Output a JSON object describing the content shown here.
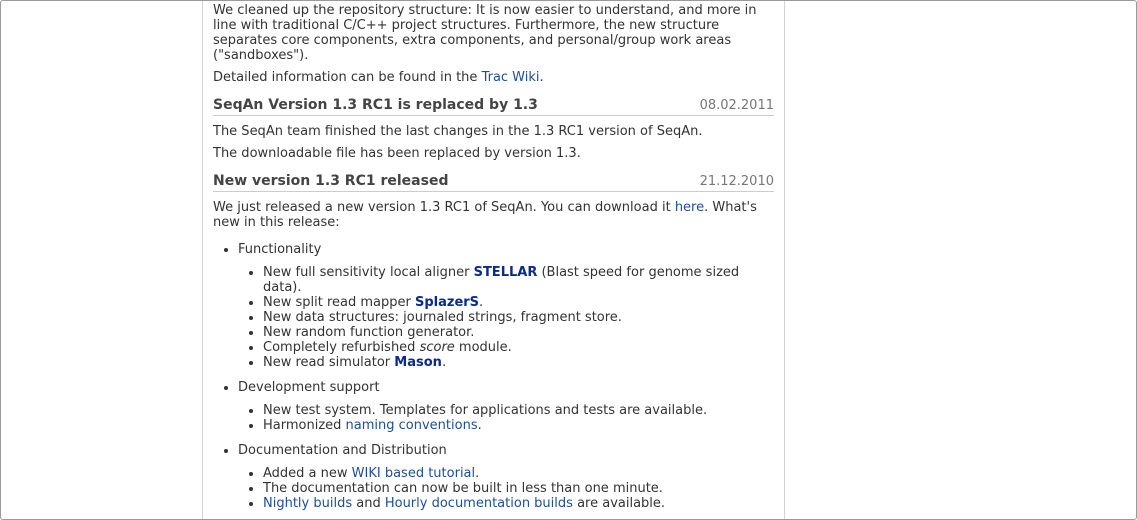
{
  "intro": {
    "p1": "We cleaned up the repository structure: It is now easier to understand, and more in line with traditional C/C++ project structures. Furthermore, the new structure separates core components, extra components, and personal/group work areas (\"sandboxes\").",
    "p2_before": "Detailed information can be found in the ",
    "p2_link": "Trac Wiki",
    "p2_after": "."
  },
  "news1": {
    "title": "SeqAn Version 1.3 RC1 is replaced by 1.3",
    "date": "08.02.2011",
    "p1": "The SeqAn team finished the last changes in the 1.3 RC1 version of SeqAn.",
    "p2": "The downloadable file has been replaced by version 1.3."
  },
  "news2": {
    "title": "New version 1.3 RC1 released",
    "date": "21.12.2010",
    "intro_before": "We just released a new version 1.3 RC1 of SeqAn. You can download it ",
    "intro_link": "here",
    "intro_after": ". What's new in this release:",
    "functionality": {
      "label": "Functionality",
      "item1_before": "New full sensitivity local aligner ",
      "item1_link": "STELLAR",
      "item1_after": " (Blast speed for genome sized data).",
      "item2_before": "New split read mapper ",
      "item2_link": "SplazerS",
      "item2_after": ".",
      "item3": "New data structures: journaled strings, fragment store.",
      "item4": "New random function generator.",
      "item5_before": "Completely refurbished ",
      "item5_em": "score",
      "item5_after": " module.",
      "item6_before": "New read simulator ",
      "item6_link": "Mason",
      "item6_after": "."
    },
    "development": {
      "label": "Development support",
      "item1": "New test system. Templates for applications and tests are available.",
      "item2_before": "Harmonized ",
      "item2_link": "naming conventions",
      "item2_after": "."
    },
    "documentation": {
      "label": "Documentation and Distribution",
      "item1_before": "Added a new ",
      "item1_link": "WIKI based tutorial",
      "item1_after": ".",
      "item2": "The documentation can now be built in less than one minute.",
      "item3_link1": "Nightly builds",
      "item3_mid": " and ",
      "item3_link2": "Hourly documentation builds",
      "item3_after": " are available."
    }
  }
}
